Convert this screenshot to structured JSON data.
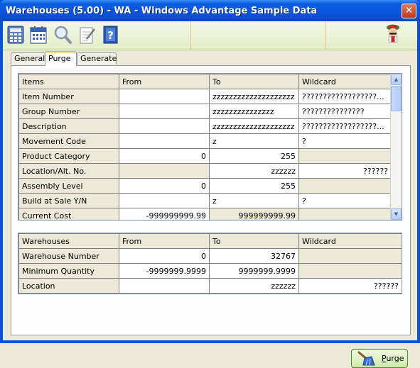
{
  "window": {
    "title": "Warehouses (5.00) - WA - Windows Advantage Sample Data",
    "close_symbol": "✕"
  },
  "toolbar": {
    "icons": [
      "calculator-icon",
      "calendar-icon",
      "magnifier-icon",
      "notepad-icon",
      "help-book-icon",
      "mascot-icon"
    ],
    "help_glyph": "?"
  },
  "tabs": [
    {
      "label": "General"
    },
    {
      "label": "Purge"
    },
    {
      "label": "Generate"
    }
  ],
  "active_tab": "Purge",
  "items_grid": {
    "headers": [
      "Items",
      "From",
      "To",
      "Wildcard"
    ],
    "rows": [
      {
        "label": "Item Number",
        "from": "",
        "to": "zzzzzzzzzzzzzzzzzzzz",
        "wildcard": "??????????????????..."
      },
      {
        "label": "Group Number",
        "from": "",
        "to": "zzzzzzzzzzzzzzz",
        "wildcard": "???????????????"
      },
      {
        "label": "Description",
        "from": "",
        "to": "zzzzzzzzzzzzzzzzzzzz",
        "wildcard": "??????????????????..."
      },
      {
        "label": "Movement Code",
        "from": "",
        "to": "z",
        "wildcard": "?"
      },
      {
        "label": "Product Category",
        "from": "0",
        "to": "255",
        "wildcard": ""
      },
      {
        "label": "Location/Alt. No.",
        "from": "",
        "to": "zzzzzz",
        "wildcard": "??????"
      },
      {
        "label": "Assembly Level",
        "from": "0",
        "to": "255",
        "wildcard": ""
      },
      {
        "label": "Build at Sale Y/N",
        "from": "",
        "to": "z",
        "wildcard": "?"
      },
      {
        "label": "Current Cost",
        "from": "-999999999.99",
        "to": "999999999.99",
        "wildcard": ""
      }
    ]
  },
  "warehouses_grid": {
    "headers": [
      "Warehouses",
      "From",
      "To",
      "Wildcard"
    ],
    "rows": [
      {
        "label": "Warehouse Number",
        "from": "0",
        "to": "32767",
        "wildcard": ""
      },
      {
        "label": "Minimum Quantity",
        "from": "-9999999.9999",
        "to": "9999999.9999",
        "wildcard": ""
      },
      {
        "label": "Location",
        "from": "",
        "to": "zzzzzz",
        "wildcard": "??????"
      }
    ]
  },
  "purge_button": {
    "label_hotkey": "P",
    "label_rest": "urge",
    "icon": "broom-icon"
  },
  "colors": {
    "title_blue": "#0a55dc",
    "accent_orange": "#f9b73c",
    "grid_readonly": "#ece9d8"
  }
}
